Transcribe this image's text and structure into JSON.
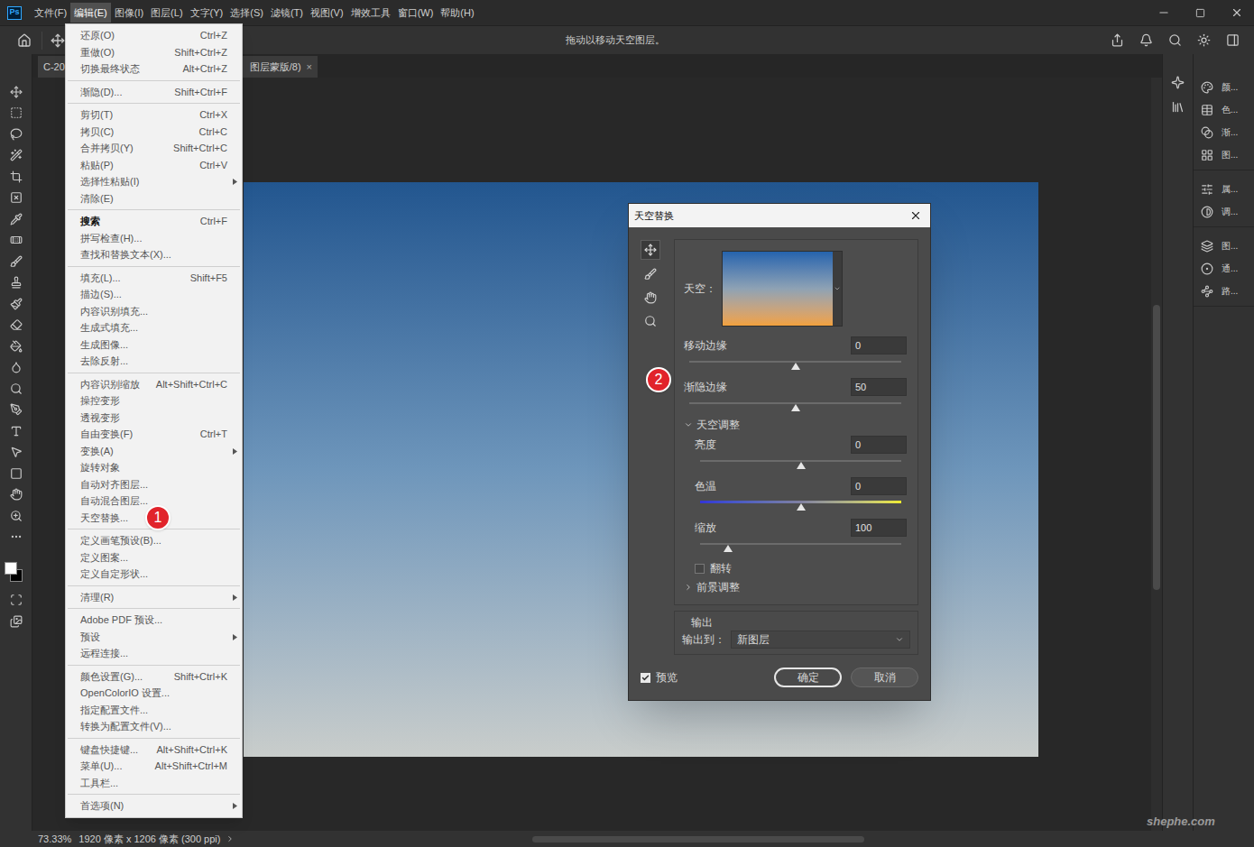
{
  "menubar": {
    "logo": "Ps",
    "items": [
      {
        "label": "文件(F)",
        "selected": false
      },
      {
        "label": "编辑(E)",
        "selected": true
      },
      {
        "label": "图像(I)",
        "selected": false
      },
      {
        "label": "图层(L)",
        "selected": false
      },
      {
        "label": "文字(Y)",
        "selected": false
      },
      {
        "label": "选择(S)",
        "selected": false
      },
      {
        "label": "滤镜(T)",
        "selected": false
      },
      {
        "label": "视图(V)",
        "selected": false
      },
      {
        "label": "增效工具",
        "selected": false
      },
      {
        "label": "窗口(W)",
        "selected": false
      },
      {
        "label": "帮助(H)",
        "selected": false
      }
    ]
  },
  "options_bar": {
    "hint": "拖动以移动天空图层。"
  },
  "document_tab": {
    "label_start": "C-20",
    "label_end": "图层蒙版/8)",
    "close": "×"
  },
  "edit_menu": {
    "sections": [
      [
        {
          "label": "还原(O)",
          "shortcut": "Ctrl+Z",
          "submenu": false,
          "bold": false
        },
        {
          "label": "重做(O)",
          "shortcut": "Shift+Ctrl+Z",
          "submenu": false,
          "bold": false
        },
        {
          "label": "切换最终状态",
          "shortcut": "Alt+Ctrl+Z",
          "submenu": false,
          "bold": false
        }
      ],
      [
        {
          "label": "渐隐(D)...",
          "shortcut": "Shift+Ctrl+F",
          "submenu": false,
          "bold": false
        }
      ],
      [
        {
          "label": "剪切(T)",
          "shortcut": "Ctrl+X",
          "submenu": false,
          "bold": false
        },
        {
          "label": "拷贝(C)",
          "shortcut": "Ctrl+C",
          "submenu": false,
          "bold": false
        },
        {
          "label": "合并拷贝(Y)",
          "shortcut": "Shift+Ctrl+C",
          "submenu": false,
          "bold": false
        },
        {
          "label": "粘贴(P)",
          "shortcut": "Ctrl+V",
          "submenu": false,
          "bold": false
        },
        {
          "label": "选择性粘贴(I)",
          "shortcut": "",
          "submenu": true,
          "bold": false
        },
        {
          "label": "清除(E)",
          "shortcut": "",
          "submenu": false,
          "bold": false
        }
      ],
      [
        {
          "label": "搜索",
          "shortcut": "Ctrl+F",
          "submenu": false,
          "bold": true
        },
        {
          "label": "拼写检查(H)...",
          "shortcut": "",
          "submenu": false,
          "bold": false
        },
        {
          "label": "查找和替换文本(X)...",
          "shortcut": "",
          "submenu": false,
          "bold": false
        }
      ],
      [
        {
          "label": "填充(L)...",
          "shortcut": "Shift+F5",
          "submenu": false,
          "bold": false
        },
        {
          "label": "描边(S)...",
          "shortcut": "",
          "submenu": false,
          "bold": false
        },
        {
          "label": "内容识别填充...",
          "shortcut": "",
          "submenu": false,
          "bold": false
        },
        {
          "label": "生成式填充...",
          "shortcut": "",
          "submenu": false,
          "bold": false
        },
        {
          "label": "生成图像...",
          "shortcut": "",
          "submenu": false,
          "bold": false
        },
        {
          "label": "去除反射...",
          "shortcut": "",
          "submenu": false,
          "bold": false
        }
      ],
      [
        {
          "label": "内容识别缩放",
          "shortcut": "Alt+Shift+Ctrl+C",
          "submenu": false,
          "bold": false
        },
        {
          "label": "操控变形",
          "shortcut": "",
          "submenu": false,
          "bold": false
        },
        {
          "label": "透视变形",
          "shortcut": "",
          "submenu": false,
          "bold": false
        },
        {
          "label": "自由变换(F)",
          "shortcut": "Ctrl+T",
          "submenu": false,
          "bold": false
        },
        {
          "label": "变换(A)",
          "shortcut": "",
          "submenu": true,
          "bold": false
        },
        {
          "label": "旋转对象",
          "shortcut": "",
          "submenu": false,
          "bold": false
        },
        {
          "label": "自动对齐图层...",
          "shortcut": "",
          "submenu": false,
          "bold": false
        },
        {
          "label": "自动混合图层...",
          "shortcut": "",
          "submenu": false,
          "bold": false
        },
        {
          "label": "天空替换...",
          "shortcut": "",
          "submenu": false,
          "bold": false,
          "badge": "1"
        }
      ],
      [
        {
          "label": "定义画笔预设(B)...",
          "shortcut": "",
          "submenu": false,
          "bold": false
        },
        {
          "label": "定义图案...",
          "shortcut": "",
          "submenu": false,
          "bold": false
        },
        {
          "label": "定义自定形状...",
          "shortcut": "",
          "submenu": false,
          "bold": false
        }
      ],
      [
        {
          "label": "清理(R)",
          "shortcut": "",
          "submenu": true,
          "bold": false
        }
      ],
      [
        {
          "label": "Adobe PDF 预设...",
          "shortcut": "",
          "submenu": false,
          "bold": false
        },
        {
          "label": "预设",
          "shortcut": "",
          "submenu": true,
          "bold": false
        },
        {
          "label": "远程连接...",
          "shortcut": "",
          "submenu": false,
          "bold": false
        }
      ],
      [
        {
          "label": "颜色设置(G)...",
          "shortcut": "Shift+Ctrl+K",
          "submenu": false,
          "bold": false
        },
        {
          "label": "OpenColorIO 设置...",
          "shortcut": "",
          "submenu": false,
          "bold": false
        },
        {
          "label": "指定配置文件...",
          "shortcut": "",
          "submenu": false,
          "bold": false
        },
        {
          "label": "转换为配置文件(V)...",
          "shortcut": "",
          "submenu": false,
          "bold": false
        }
      ],
      [
        {
          "label": "键盘快捷键...",
          "shortcut": "Alt+Shift+Ctrl+K",
          "submenu": false,
          "bold": false
        },
        {
          "label": "菜单(U)...",
          "shortcut": "Alt+Shift+Ctrl+M",
          "submenu": false,
          "bold": false
        },
        {
          "label": "工具栏...",
          "shortcut": "",
          "submenu": false,
          "bold": false
        }
      ],
      [
        {
          "label": "首选项(N)",
          "shortcut": "",
          "submenu": true,
          "bold": false
        }
      ]
    ]
  },
  "dialog": {
    "title": "天空替换",
    "badge": "2",
    "sky_label": "天空：",
    "sliders": [
      {
        "label": "移动边缘",
        "value": "0",
        "level": 0.5
      },
      {
        "label": "渐隐边缘",
        "value": "50",
        "level": 0.5
      }
    ],
    "sky_adjust": {
      "label": "天空调整",
      "expanded": true,
      "sliders": [
        {
          "label": "亮度",
          "value": "0",
          "level": 0.5,
          "kind": "plain"
        },
        {
          "label": "色温",
          "value": "0",
          "level": 0.5,
          "kind": "temperature"
        },
        {
          "label": "缩放",
          "value": "100",
          "level": 0.14,
          "kind": "plain"
        }
      ],
      "flip": {
        "label": "翻转",
        "checked": false
      }
    },
    "foreground_adjust": {
      "label": "前景调整",
      "expanded": false
    },
    "output": {
      "title": "输出",
      "label": "输出到：",
      "value": "新图层"
    },
    "preview": {
      "label": "预览",
      "checked": true
    },
    "buttons": [
      {
        "label": "确定",
        "primary": true
      },
      {
        "label": "取消",
        "primary": false
      }
    ]
  },
  "right_panels": {
    "groups": [
      [
        {
          "label": "颜..."
        },
        {
          "label": "色..."
        },
        {
          "label": "渐..."
        },
        {
          "label": "图..."
        }
      ],
      [
        {
          "label": "属..."
        },
        {
          "label": "调..."
        }
      ],
      [
        {
          "label": "图..."
        },
        {
          "label": "通..."
        },
        {
          "label": "路..."
        }
      ]
    ]
  },
  "status_bar": {
    "zoom": "73.33%",
    "info": "1920 像素 x 1206 像素 (300 ppi)"
  },
  "watermark": "shephe.com"
}
